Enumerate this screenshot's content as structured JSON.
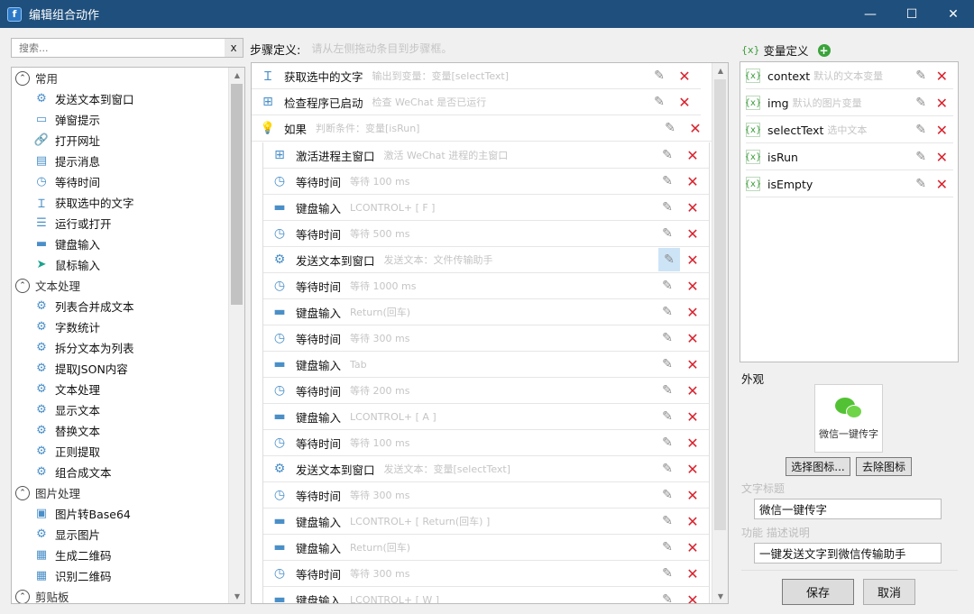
{
  "window": {
    "title": "编辑组合动作",
    "app_icon": "f",
    "minimize": "—",
    "maximize": "☐",
    "close": "✕"
  },
  "left": {
    "search_placeholder": "搜索...",
    "clear_label": "x",
    "groups": [
      {
        "label": "常用",
        "items": [
          {
            "label": "发送文本到窗口",
            "icon": "gear-icon"
          },
          {
            "label": "弹窗提示",
            "icon": "window-icon"
          },
          {
            "label": "打开网址",
            "icon": "link-icon"
          },
          {
            "label": "提示消息",
            "icon": "message-icon"
          },
          {
            "label": "等待时间",
            "icon": "clock-icon"
          },
          {
            "label": "获取选中的文字",
            "icon": "cursor-text-icon"
          },
          {
            "label": "运行或打开",
            "icon": "run-icon"
          },
          {
            "label": "键盘输入",
            "icon": "keyboard-icon"
          },
          {
            "label": "鼠标输入",
            "icon": "mouse-pointer-icon"
          }
        ]
      },
      {
        "label": "文本处理",
        "items": [
          {
            "label": "列表合并成文本",
            "icon": "gear-icon"
          },
          {
            "label": "字数统计",
            "icon": "gear-icon"
          },
          {
            "label": "拆分文本为列表",
            "icon": "gear-icon"
          },
          {
            "label": "提取JSON内容",
            "icon": "gear-icon"
          },
          {
            "label": "文本处理",
            "icon": "gear-icon"
          },
          {
            "label": "显示文本",
            "icon": "gear-icon"
          },
          {
            "label": "替换文本",
            "icon": "gear-icon"
          },
          {
            "label": "正则提取",
            "icon": "gear-icon"
          },
          {
            "label": "组合成文本",
            "icon": "gear-icon"
          }
        ]
      },
      {
        "label": "图片处理",
        "items": [
          {
            "label": "图片转Base64",
            "icon": "image-icon"
          },
          {
            "label": "显示图片",
            "icon": "gear-icon"
          },
          {
            "label": "生成二维码",
            "icon": "qrcode-icon"
          },
          {
            "label": "识别二维码",
            "icon": "qrcode-icon"
          }
        ]
      },
      {
        "label": "剪贴板",
        "items": []
      }
    ]
  },
  "steps": {
    "header": "步骤定义:",
    "hint": "请从左侧拖动条目到步骤框。",
    "top": [
      {
        "name": "获取选中的文字",
        "desc": "输出到变量：变量[selectText]",
        "icon": "cursor-text-icon"
      },
      {
        "name": "检查程序已启动",
        "desc": "检查 WeChat 是否已运行",
        "icon": "windows-icon"
      },
      {
        "name": "如果",
        "desc": "判断条件：变量[isRun]",
        "icon": "bulb-icon"
      }
    ],
    "nested": [
      {
        "name": "激活进程主窗口",
        "desc": "激活 WeChat 进程的主窗口",
        "icon": "windows-icon"
      },
      {
        "name": "等待时间",
        "desc": "等待 100 ms",
        "icon": "clock-icon"
      },
      {
        "name": "键盘输入",
        "desc": "LCONTROL+ [ F ]",
        "icon": "keyboard-icon"
      },
      {
        "name": "等待时间",
        "desc": "等待 500 ms",
        "icon": "clock-icon"
      },
      {
        "name": "发送文本到窗口",
        "desc": "发送文本：文件传输助手",
        "icon": "gear-icon"
      },
      {
        "name": "等待时间",
        "desc": "等待 1000 ms",
        "icon": "clock-icon"
      },
      {
        "name": "键盘输入",
        "desc": "Return(回车)",
        "icon": "keyboard-icon"
      },
      {
        "name": "等待时间",
        "desc": "等待 300 ms",
        "icon": "clock-icon"
      },
      {
        "name": "键盘输入",
        "desc": "Tab",
        "icon": "keyboard-icon"
      },
      {
        "name": "等待时间",
        "desc": "等待 200 ms",
        "icon": "clock-icon"
      },
      {
        "name": "键盘输入",
        "desc": "LCONTROL+ [ A ]",
        "icon": "keyboard-icon"
      },
      {
        "name": "等待时间",
        "desc": "等待 100 ms",
        "icon": "clock-icon"
      },
      {
        "name": "发送文本到窗口",
        "desc": "发送文本：变量[selectText]",
        "icon": "gear-icon"
      },
      {
        "name": "等待时间",
        "desc": "等待 300 ms",
        "icon": "clock-icon"
      },
      {
        "name": "键盘输入",
        "desc": "LCONTROL+ [ Return(回车) ]",
        "icon": "keyboard-icon"
      },
      {
        "name": "键盘输入",
        "desc": "Return(回车)",
        "icon": "keyboard-icon"
      },
      {
        "name": "等待时间",
        "desc": "等待 300 ms",
        "icon": "clock-icon"
      },
      {
        "name": "键盘输入",
        "desc": "LCONTROL+ [ W ]",
        "icon": "keyboard-icon"
      }
    ]
  },
  "vars": {
    "header": "变量定义",
    "items": [
      {
        "name": "context",
        "desc": "默认的文本变量"
      },
      {
        "name": "img",
        "desc": "默认的图片变量"
      },
      {
        "name": "selectText",
        "desc": "选中文本"
      },
      {
        "name": "isRun",
        "desc": ""
      },
      {
        "name": "isEmpty",
        "desc": ""
      }
    ]
  },
  "appearance": {
    "label": "外观",
    "preview_title": "微信一键传字",
    "choose_icon": "选择图标...",
    "remove_icon": "去除图标",
    "title_label": "文字标题",
    "title_value": "微信一键传字",
    "desc_label": "功能 描述说明",
    "desc_value": "一键发送文字到微信传输助手"
  },
  "footer": {
    "save": "保存",
    "cancel": "取消"
  },
  "colors": {
    "titlebar": "#1f4f7c",
    "delete_red": "#d9232e",
    "var_green": "#3a9b3a",
    "icon_blue": "#4a8fc8"
  }
}
